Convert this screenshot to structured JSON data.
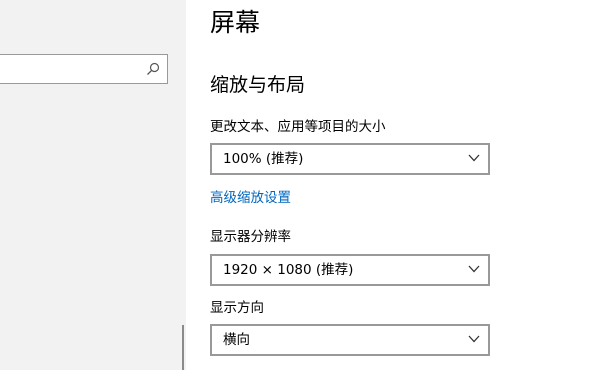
{
  "nav": {
    "search": {
      "value": "",
      "icon": "search-icon"
    }
  },
  "page": {
    "title": "屏幕"
  },
  "scale_layout": {
    "title": "缩放与布局",
    "scale": {
      "label": "更改文本、应用等项目的大小",
      "value": "100% (推荐)"
    },
    "advanced_link": "高级缩放设置",
    "resolution": {
      "label": "显示器分辨率",
      "value": "1920 × 1080 (推荐)"
    },
    "orientation": {
      "label": "显示方向",
      "value": "横向"
    }
  },
  "colors": {
    "link": "#0067c0",
    "nav_background": "#f2f2f2",
    "border": "#999999"
  }
}
